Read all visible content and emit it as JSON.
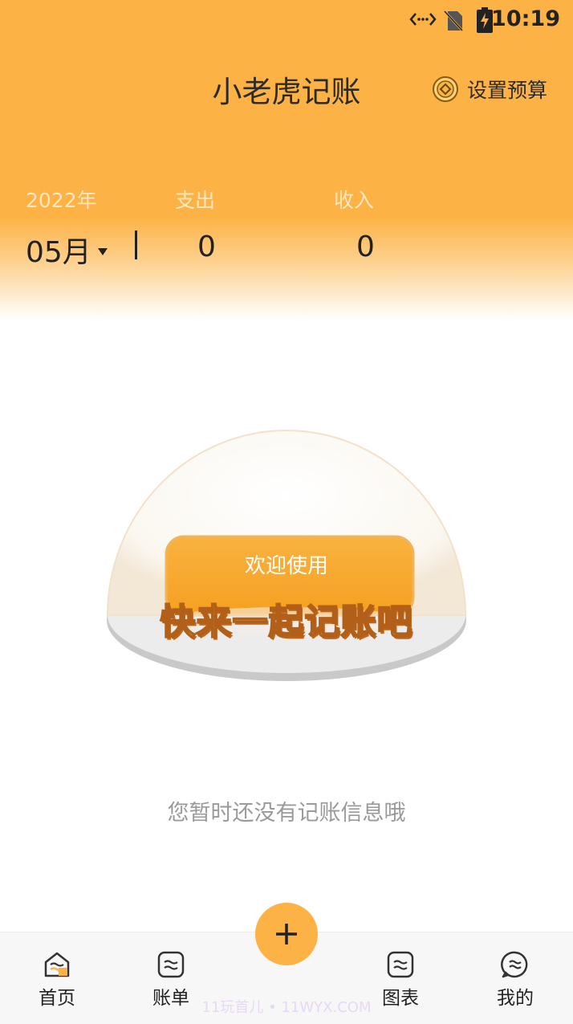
{
  "status_bar": {
    "time": "10:19",
    "icons": [
      "code-brackets-icon",
      "no-sim-icon",
      "battery-charging-icon"
    ]
  },
  "header": {
    "title": "小老虎记账",
    "budget_label": "设置预算",
    "budget_icon": "coin-icon"
  },
  "summary": {
    "year": "2022年",
    "month": "05月",
    "expense_label": "支出",
    "income_label": "收入",
    "expense_value": "0",
    "income_value": "0"
  },
  "illustration": {
    "welcome_small": "欢迎使用",
    "welcome_big": "快来一起记账吧"
  },
  "empty_state": {
    "message": "您暂时还没有记账信息哦"
  },
  "nav": {
    "items": [
      {
        "label": "首页",
        "icon": "home-icon",
        "active": true
      },
      {
        "label": "账单",
        "icon": "bill-icon",
        "active": false
      },
      {
        "label": "图表",
        "icon": "chart-icon",
        "active": false
      },
      {
        "label": "我的",
        "icon": "profile-icon",
        "active": false
      }
    ],
    "add_icon": "plus-icon"
  },
  "watermark": "11玩首儿 • 11WYX.COM",
  "colors": {
    "accent": "#fdb245",
    "text": "#222222",
    "muted": "#9a9a9a"
  }
}
